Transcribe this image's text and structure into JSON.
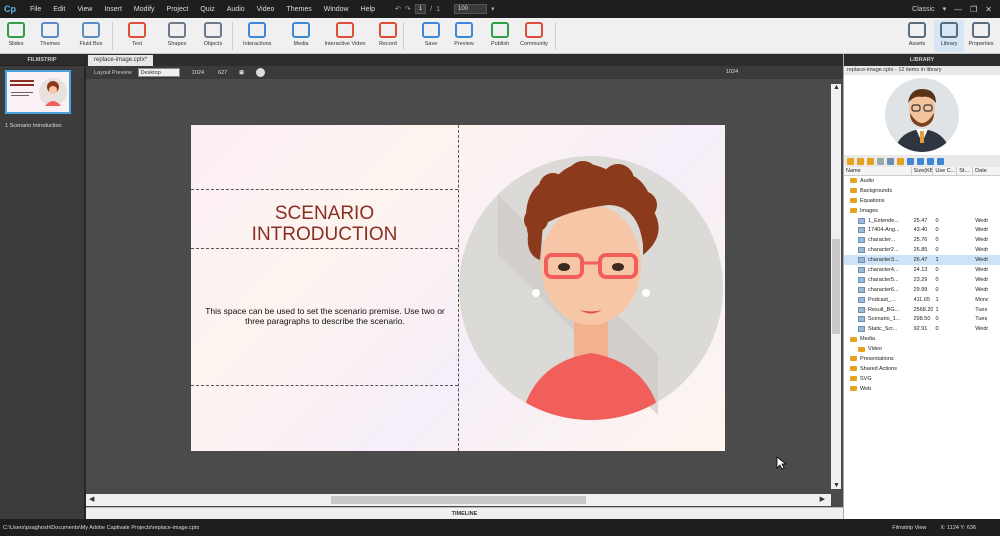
{
  "app": {
    "logo": "Cp",
    "mode": "Classic"
  },
  "menu": [
    "File",
    "Edit",
    "View",
    "Insert",
    "Modify",
    "Project",
    "Quiz",
    "Audio",
    "Video",
    "Themes",
    "Window",
    "Help"
  ],
  "menu_tools": {
    "page": "1",
    "separator": "/",
    "total": "1",
    "zoom": "100"
  },
  "toolbar": {
    "left": [
      {
        "label": "Slides",
        "icon": "add-slide-icon",
        "color": "#2f9e44"
      },
      {
        "label": "Themes",
        "icon": "themes-icon",
        "color": "#5b8cc4"
      },
      {
        "label": "Fluid Box",
        "icon": "fluid-box-icon",
        "color": "#5b8cc4"
      },
      {
        "label": "Text",
        "icon": "text-icon",
        "color": "#e04e3a"
      },
      {
        "label": "Shapes",
        "icon": "shapes-icon",
        "color": "#6c7a89"
      },
      {
        "label": "Objects",
        "icon": "objects-icon",
        "color": "#6c7a89"
      },
      {
        "label": "Interactions",
        "icon": "interactions-icon",
        "color": "#3e86d6"
      },
      {
        "label": "Media",
        "icon": "media-icon",
        "color": "#3e86d6"
      },
      {
        "label": "Interactive Video",
        "icon": "interactive-video-icon",
        "color": "#e04e3a"
      },
      {
        "label": "Record",
        "icon": "record-icon",
        "color": "#e04e3a"
      },
      {
        "label": "Save",
        "icon": "save-icon",
        "color": "#3e86d6"
      },
      {
        "label": "Preview",
        "icon": "preview-icon",
        "color": "#3e86d6"
      },
      {
        "label": "Publish",
        "icon": "publish-icon",
        "color": "#2f9e44"
      },
      {
        "label": "Community",
        "icon": "community-icon",
        "color": "#e04e3a"
      }
    ],
    "right": [
      {
        "label": "Assets",
        "icon": "assets-icon"
      },
      {
        "label": "Library",
        "icon": "library-icon"
      },
      {
        "label": "Properties",
        "icon": "properties-icon"
      }
    ]
  },
  "filmstrip": {
    "title": "FILMSTRIP",
    "slide_label": "1 Scenario Introduction"
  },
  "document": {
    "tab": "replace-image.cptx*"
  },
  "preview_bar": {
    "label": "Layout Preview",
    "device": "Desktop",
    "width": "1024",
    "height": "627",
    "ruler": "1024"
  },
  "slide": {
    "title_line1": "SCENARIO",
    "title_line2": "INTRODUCTION",
    "body": "This space can be used to set the scenario premise. Use two or three paragraphs to describe the scenario."
  },
  "timeline": "TIMELINE",
  "library": {
    "title": "LIBRARY",
    "info": "replace-image.cptx - 12 items in library",
    "columns": [
      "Name",
      "Size(KB)",
      "Use C...",
      "St...",
      "Date"
    ],
    "rows": [
      {
        "type": "folder",
        "indent": 1,
        "name": "Audio",
        "size": "",
        "use": "",
        "st": "",
        "date": ""
      },
      {
        "type": "folder",
        "indent": 1,
        "name": "Backgrounds",
        "size": "",
        "use": "",
        "st": "",
        "date": ""
      },
      {
        "type": "folder",
        "indent": 1,
        "name": "Equations",
        "size": "",
        "use": "",
        "st": "",
        "date": ""
      },
      {
        "type": "folder",
        "indent": 1,
        "name": "Images",
        "size": "",
        "use": "",
        "st": "",
        "date": "",
        "open": true
      },
      {
        "type": "image",
        "indent": 2,
        "name": "1_Extende...",
        "size": "25.47",
        "use": "0",
        "st": "",
        "date": "Wedr"
      },
      {
        "type": "image",
        "indent": 2,
        "name": "17404-Ang...",
        "size": "43.40",
        "use": "0",
        "st": "",
        "date": "Wedr"
      },
      {
        "type": "image",
        "indent": 2,
        "name": "character...",
        "size": "25.76",
        "use": "0",
        "st": "",
        "date": "Wedr"
      },
      {
        "type": "image",
        "indent": 2,
        "name": "character2...",
        "size": "26.85",
        "use": "0",
        "st": "",
        "date": "Wedr"
      },
      {
        "type": "image",
        "indent": 2,
        "name": "character3...",
        "size": "26.47",
        "use": "1",
        "st": "",
        "date": "Wedr",
        "selected": true
      },
      {
        "type": "image",
        "indent": 2,
        "name": "character4...",
        "size": "24.13",
        "use": "0",
        "st": "",
        "date": "Wedr"
      },
      {
        "type": "image",
        "indent": 2,
        "name": "character5...",
        "size": "23.29",
        "use": "0",
        "st": "",
        "date": "Wedr"
      },
      {
        "type": "image",
        "indent": 2,
        "name": "character6...",
        "size": "29.99",
        "use": "0",
        "st": "",
        "date": "Wedr"
      },
      {
        "type": "image",
        "indent": 2,
        "name": "Podcast_...",
        "size": "411.65",
        "use": "1",
        "st": "",
        "date": "Monc"
      },
      {
        "type": "image",
        "indent": 2,
        "name": "Result_BG...",
        "size": "2568.20",
        "use": "1",
        "st": "",
        "date": "Tues"
      },
      {
        "type": "image",
        "indent": 2,
        "name": "Scenario_1...",
        "size": "298.50",
        "use": "0",
        "st": "",
        "date": "Tues"
      },
      {
        "type": "image",
        "indent": 2,
        "name": "Static_Scr...",
        "size": "92.91",
        "use": "0",
        "st": "",
        "date": "Wedr"
      },
      {
        "type": "folder",
        "indent": 1,
        "name": "Media",
        "size": "",
        "use": "",
        "st": "",
        "date": "",
        "open": true
      },
      {
        "type": "folder",
        "indent": 2,
        "name": "Video",
        "size": "",
        "use": "",
        "st": "",
        "date": ""
      },
      {
        "type": "folder",
        "indent": 1,
        "name": "Presentations",
        "size": "",
        "use": "",
        "st": "",
        "date": ""
      },
      {
        "type": "folder",
        "indent": 1,
        "name": "Shared Actions",
        "size": "",
        "use": "",
        "st": "",
        "date": ""
      },
      {
        "type": "folder",
        "indent": 1,
        "name": "SVG",
        "size": "",
        "use": "",
        "st": "",
        "date": ""
      },
      {
        "type": "folder",
        "indent": 1,
        "name": "Web",
        "size": "",
        "use": "",
        "st": "",
        "date": ""
      }
    ]
  },
  "status": {
    "path": "C:\\Users\\psaghosh\\Documents\\My Adobe Captivate Projects\\replace-image.cptx",
    "view": "Filmstrip View",
    "coords": "X: 1124 Y: 636"
  },
  "colors": {
    "accent": "#4aa3df",
    "title_text": "#8a2e22",
    "selection": "#cde3f7"
  }
}
